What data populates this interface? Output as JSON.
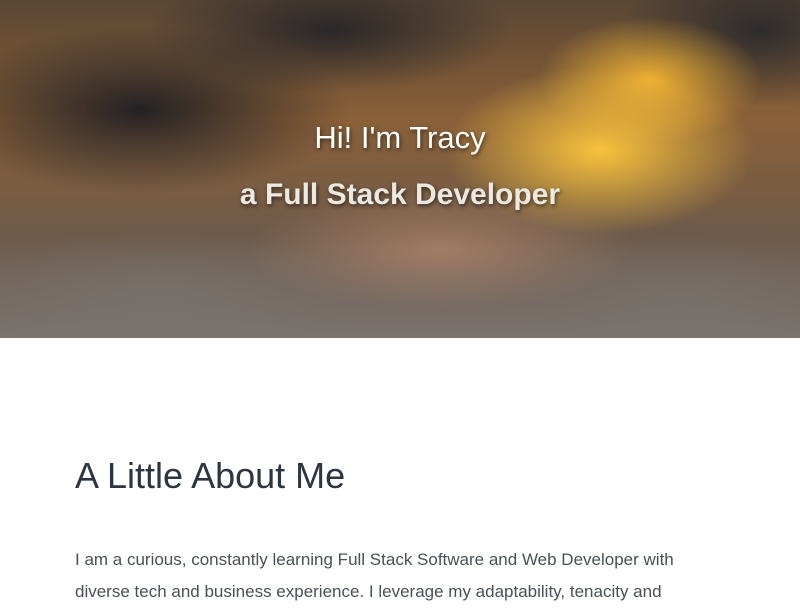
{
  "hero": {
    "title": "Hi! I'm Tracy",
    "subtitle": "a Full Stack Developer"
  },
  "about": {
    "heading": "A Little About Me",
    "paragraph": "I am a curious, constantly learning Full Stack Software and Web Developer with diverse tech and business experience. I leverage my adaptability, tenacity and"
  }
}
